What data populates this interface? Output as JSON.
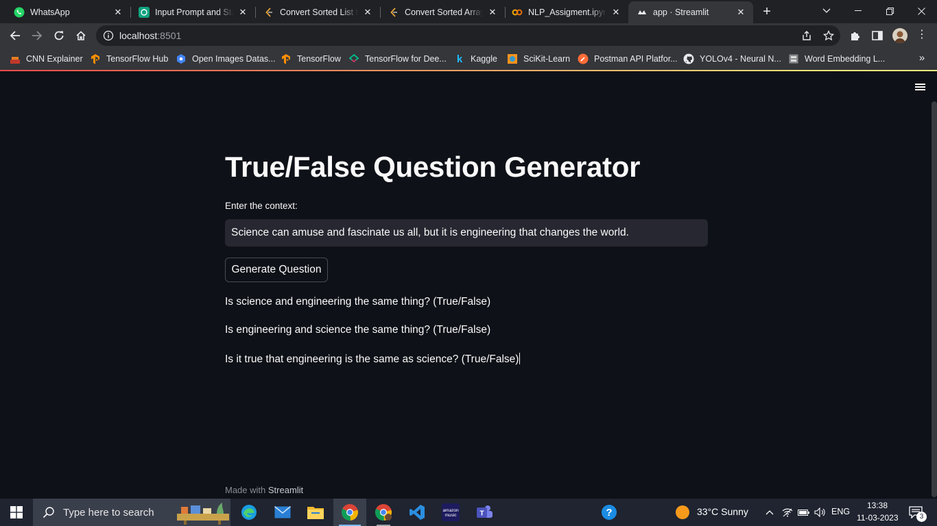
{
  "browser": {
    "tabs": [
      {
        "title": "WhatsApp",
        "icon": "whatsapp-icon",
        "active": false
      },
      {
        "title": "Input Prompt and Stat",
        "icon": "chatgpt-icon",
        "active": false
      },
      {
        "title": "Convert Sorted List to",
        "icon": "leetcode-icon",
        "active": false
      },
      {
        "title": "Convert Sorted Array t",
        "icon": "leetcode-icon",
        "active": false
      },
      {
        "title": "NLP_Assigment.ipynb",
        "icon": "colab-icon",
        "active": false
      },
      {
        "title": "app · Streamlit",
        "icon": "streamlit-icon",
        "active": true
      }
    ],
    "url_host": "localhost",
    "url_port": ":8501",
    "bookmarks": [
      {
        "label": "CNN Explainer",
        "icon": "cnn-explainer-icon"
      },
      {
        "label": "TensorFlow Hub",
        "icon": "tensorflow-icon"
      },
      {
        "label": "Open Images Datas...",
        "icon": "google-cloud-icon"
      },
      {
        "label": "TensorFlow",
        "icon": "tensorflow-icon"
      },
      {
        "label": "TensorFlow for Dee...",
        "icon": "course-icon"
      },
      {
        "label": "Kaggle",
        "icon": "kaggle-icon"
      },
      {
        "label": "SciKit-Learn",
        "icon": "scikit-learn-icon"
      },
      {
        "label": "Postman API Platfor...",
        "icon": "postman-icon"
      },
      {
        "label": "YOLOv4 - Neural N...",
        "icon": "github-icon"
      },
      {
        "label": "Word Embedding L...",
        "icon": "document-icon"
      }
    ]
  },
  "app": {
    "title": "True/False Question Generator",
    "context_label": "Enter the context:",
    "context_value": "Science can amuse and fascinate us all, but it is engineering that changes the world.",
    "button_label": "Generate Question",
    "questions": [
      "Is science and engineering the same thing? (True/False)",
      "Is engineering and science the same thing? (True/False)",
      "Is it true that engineering is the same as science? (True/False)"
    ],
    "footer_prefix": "Made with ",
    "footer_brand": "Streamlit"
  },
  "taskbar": {
    "search_placeholder": "Type here to search",
    "weather": "33°C  Sunny",
    "language": "ENG",
    "time": "13:38",
    "date": "11-03-2023",
    "notification_count": "3"
  },
  "colors": {
    "page_bg": "#0e1117",
    "input_bg": "#262730",
    "text": "#fafafa",
    "accent_gradient_start": "#ff4b4b"
  }
}
